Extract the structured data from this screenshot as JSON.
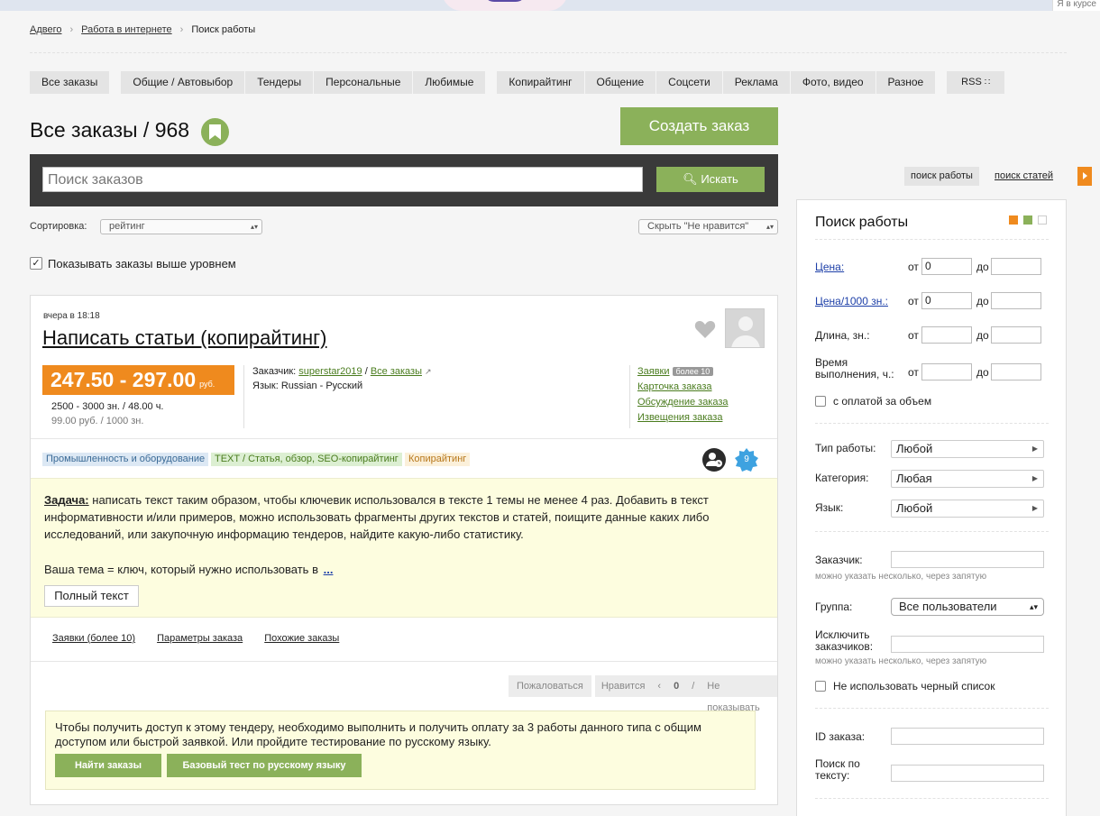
{
  "topbar": {
    "course_link": "Я в курсе"
  },
  "breadcrumb": {
    "items": [
      "Адвего",
      "Работа в интернете"
    ],
    "current": "Поиск работы",
    "sep": "›"
  },
  "tabs": {
    "group1": [
      "Все заказы"
    ],
    "group2": [
      "Общие / Автовыбор",
      "Тендеры",
      "Персональные",
      "Любимые"
    ],
    "group3": [
      "Копирайтинг",
      "Общение",
      "Соцсети",
      "Реклама",
      "Фото, видео",
      "Разное"
    ],
    "rss": "RSS"
  },
  "page": {
    "title": "Все заказы / 968",
    "create_button": "Создать заказ"
  },
  "search": {
    "placeholder": "Поиск заказов",
    "button": "Искать"
  },
  "sort": {
    "label": "Сортировка:",
    "value": "рейтинг",
    "hide_value": "Скрыть \"Не нравится\""
  },
  "show_higher": {
    "label": "Показывать заказы выше уровнем",
    "checked": true
  },
  "order": {
    "time": "вчера в 18:18",
    "title": "Написать статьи (копирайтинг)",
    "price": "247.50 - 297.00",
    "price_unit": "руб.",
    "length_info": "2500 - 3000 зн. / 48.00 ч.",
    "per_1000": "99.00 руб. / 1000 зн.",
    "customer_label": "Заказчик:",
    "customer": "superstar2019",
    "slash": "/",
    "all_orders": "Все заказы",
    "language": "Язык: Russian - Русский",
    "links": {
      "bids": "Заявки",
      "bids_badge": "более 10",
      "card": "Карточка заказа",
      "discussion": "Обсуждение заказа",
      "notices": "Извещения заказа"
    },
    "tags": [
      "Промышленность и оборудование",
      "TEXT / Статья, обзор, SEO-копирайтинг",
      "Копирайтинг"
    ],
    "badge_count": "9",
    "task_label": "Задача:",
    "task_text": "написать текст таким образом, чтобы ключевик использовался в тексте 1 темы не менее 4 раз. Добавить в текст информативности и/или примеров, можно использовать фрагменты других текстов и статей, поищите данные каких либо исследований, или закупочную информацию тендеров, найдите какую-либо статистику.",
    "task_text2": "Ваша тема = ключ, который нужно использовать в",
    "more": "...",
    "full_text_button": "Полный текст",
    "sublinks": [
      "Заявки (более 10)",
      "Параметры заказа",
      "Похожие заказы"
    ],
    "complain": "Пожаловаться",
    "like": "Нравится",
    "score": "0",
    "hide": "Не показывать",
    "notice_text": "Чтобы получить доступ к этому тендеру, необходимо выполнить и получить оплату за 3 работы данного типа с общим доступом или быстрой заявкой. Или пройдите тестирование по русскому языку.",
    "find_button": "Найти заказы",
    "test_button": "Базовый тест по русскому языку"
  },
  "sidebar": {
    "tab_jobs": "поиск работы",
    "tab_articles": "поиск статей",
    "title": "Поиск работы",
    "colors": [
      "#ef8a1e",
      "#8bb15a",
      "#ffffff"
    ],
    "price_label": "Цена:",
    "price1000_label": "Цена/1000 зн.:",
    "length_label": "Длина, зн.:",
    "time_label": "Время выполнения, ч.:",
    "from": "от",
    "to": "до",
    "price_from": "0",
    "price1000_from": "0",
    "volume_pay": "с оплатой за объем",
    "work_type_label": "Тип работы:",
    "work_type": "Любой",
    "category_label": "Категория:",
    "category": "Любая",
    "language_label": "Язык:",
    "language": "Любой",
    "customer_label": "Заказчик:",
    "hint": "можно указать несколько, через запятую",
    "group_label": "Группа:",
    "group": "Все пользователи",
    "exclude_label": "Исключить заказчиков:",
    "no_blacklist": "Не использовать черный список",
    "id_label": "ID заказа:",
    "text_search_label": "Поиск по тексту:"
  }
}
